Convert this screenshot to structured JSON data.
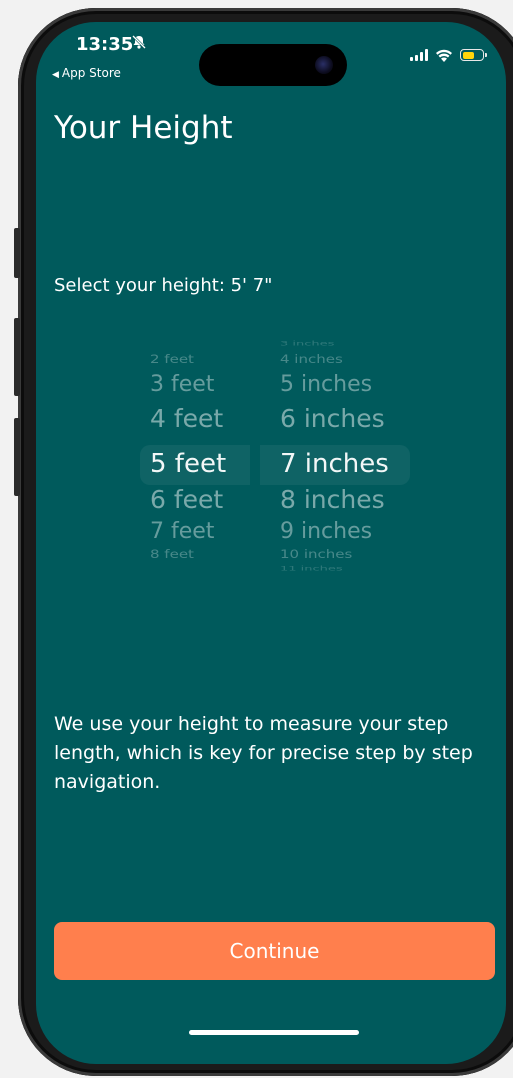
{
  "status_bar": {
    "time": "13:35",
    "back_app": "App Store",
    "battery_color": "#ffd60a"
  },
  "page": {
    "title": "Your Height",
    "subtitle": "Select your height: 5' 7\"",
    "info": "We use your height to measure your step length, which is key for precise step by step navigation.",
    "continue_label": "Continue"
  },
  "picker": {
    "feet": [
      "2 feet",
      "3 feet",
      "4 feet",
      "5 feet",
      "6 feet",
      "7 feet",
      "8 feet"
    ],
    "inches": [
      "3 inches",
      "4 inches",
      "5 inches",
      "6 inches",
      "7 inches",
      "8 inches",
      "9 inches",
      "10 inches",
      "11 inches"
    ],
    "selected_feet": "5 feet",
    "selected_inches": "7 inches"
  },
  "colors": {
    "background": "#005a5c",
    "button": "#ff7f4d"
  }
}
